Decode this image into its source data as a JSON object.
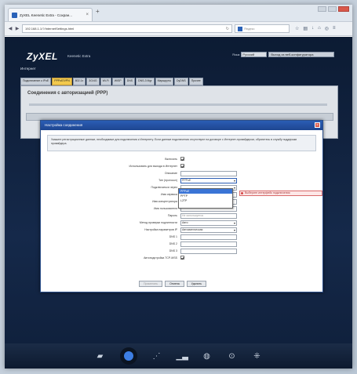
{
  "browser": {
    "tab_title": "ZyXEL Keenetic Extra - Сохран...",
    "url": "192.168.1.1/?/InternetSettings.html",
    "search_placeholder": "Яндекс"
  },
  "header": {
    "logo": "ZyXEL",
    "model": "Keenetic Extra",
    "language_label": "Язык",
    "language_value": "Русский",
    "top_button": "Выход из веб-конфигуратора",
    "page_title": "Интернет"
  },
  "tabs": [
    {
      "label": "Подключение к IPoE"
    },
    {
      "label": "PPPoE/VPN",
      "active": true
    },
    {
      "label": "802.1x"
    },
    {
      "label": "3G/4G"
    },
    {
      "label": "Wi-Fi"
    },
    {
      "label": "WISP"
    },
    {
      "label": "DNS"
    },
    {
      "label": "DNS-3 Mgr"
    },
    {
      "label": "Маршруты"
    },
    {
      "label": "DyDNS"
    },
    {
      "label": "Прочее"
    }
  ],
  "content": {
    "heading": "Соединения с авторизацией (PPP)"
  },
  "modal": {
    "title": "Настройка соединения",
    "note": "Укажите регистрационные данные, необходимые для подключения к Интернету. Если данные подключения отсутствуют на договоре с Интернет-провайдером, обратитесь в службу поддержки провайдера.",
    "fields": [
      {
        "label": "Включить",
        "type": "checkbox",
        "checked": true
      },
      {
        "label": "Использовать для выхода в Интернет",
        "type": "checkbox",
        "checked": true
      },
      {
        "label": "Описание",
        "type": "input",
        "value": ""
      },
      {
        "label": "Тип (протокол)",
        "type": "select",
        "value": "PPPoE"
      },
      {
        "label": "Подключаться через",
        "type": "select",
        "value": ""
      },
      {
        "label": "Имя сервиса",
        "type": "input",
        "value": ""
      },
      {
        "label": "Имя концентратора",
        "type": "input",
        "value": ""
      },
      {
        "label": "Имя пользователя",
        "type": "input",
        "value": ""
      },
      {
        "label": "Пароль",
        "type": "input",
        "value": "Не используется"
      },
      {
        "label": "Метод проверки подлинности",
        "type": "select",
        "value": "Авто"
      },
      {
        "label": "Настройка параметров IP",
        "type": "select",
        "value": "Автоматическая"
      },
      {
        "label": "DNS 1",
        "type": "input",
        "value": ""
      },
      {
        "label": "DNS 2",
        "type": "input",
        "value": ""
      },
      {
        "label": "DNS 3",
        "type": "input",
        "value": ""
      },
      {
        "label": "Автоподстройка TCP-MSS",
        "type": "checkbox",
        "checked": true
      }
    ],
    "dropdown_options": [
      {
        "label": "PPPoE",
        "highlighted": true
      },
      {
        "label": "PPTP"
      },
      {
        "label": "L2TP"
      }
    ],
    "hint": "Выберите интерфейс подключения",
    "buttons": {
      "apply": "Применить",
      "cancel": "Отмена",
      "delete": "Удалить"
    }
  },
  "taskbar": {
    "items": [
      "internet-icon",
      "globe-icon",
      "wifi-icon",
      "stats-icon",
      "network-icon",
      "security-icon",
      "apps-icon"
    ]
  }
}
